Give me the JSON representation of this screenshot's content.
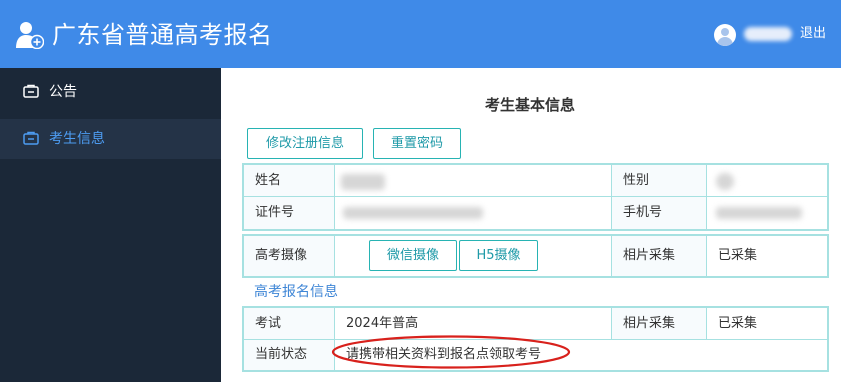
{
  "header": {
    "app_title": "广东省普通高考报名",
    "logout_label": "退出",
    "logo_icon": "user-plus-icon",
    "avatar_icon": "avatar-icon",
    "bg_color": "#3f8ae8"
  },
  "sidebar": {
    "bg_color": "#1b2838",
    "items": [
      {
        "label": "公告",
        "icon": "briefcase-icon",
        "active": false
      },
      {
        "label": "考生信息",
        "icon": "briefcase-icon",
        "active": true
      }
    ]
  },
  "main": {
    "section_title": "考生基本信息",
    "buttons": {
      "edit_registration": "修改注册信息",
      "reset_password": "重置密码"
    },
    "basic_info": {
      "name_label": "姓名",
      "gender_label": "性别",
      "id_label": "证件号",
      "phone_label": "手机号"
    },
    "photo": {
      "label": "高考摄像",
      "wechat_button": "微信摄像",
      "h5_button": "H5摄像",
      "collect_label": "相片采集",
      "collect_value": "已采集"
    },
    "exam_section_title": "高考报名信息",
    "exam_info": {
      "exam_label": "考试",
      "exam_value": "2024年普高",
      "collect_label": "相片采集",
      "collect_value": "已采集",
      "status_label": "当前状态",
      "status_value": "请携带相关资料到报名点领取考号"
    },
    "accent_color": "#27b3b3",
    "annotation_color": "#d8211c"
  }
}
